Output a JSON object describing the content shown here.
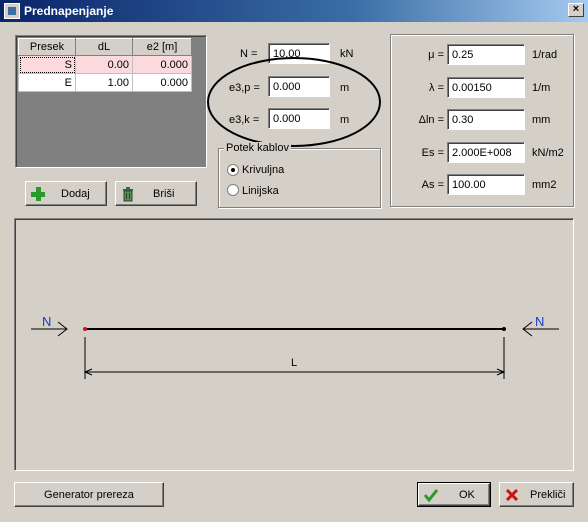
{
  "window": {
    "title": "Prednapenjanje",
    "close_glyph": "×"
  },
  "table": {
    "headers": [
      "Presek",
      "dL",
      "e2 [m]"
    ],
    "rows": [
      {
        "presek": "S",
        "dl": "0.00",
        "e2": "0.000",
        "selected": true
      },
      {
        "presek": "E",
        "dl": "1.00",
        "e2": "0.000",
        "selected": false
      }
    ]
  },
  "buttons": {
    "dodaj": "Dodaj",
    "brisi": "Briši",
    "generator": "Generator prereza",
    "ok": "OK",
    "preklici": "Prekliči"
  },
  "params": {
    "n": {
      "label": "N =",
      "value": "10.00",
      "unit": "kN"
    },
    "e3p": {
      "label": "e3,p =",
      "value": "0.000",
      "unit": "m"
    },
    "e3k": {
      "label": "e3,k =",
      "value": "0.000",
      "unit": "m"
    }
  },
  "cable_path": {
    "title": "Potek kablov",
    "options": [
      {
        "label": "Krivuljna",
        "selected": true
      },
      {
        "label": "Linijska",
        "selected": false
      }
    ]
  },
  "props": {
    "mu": {
      "label": "μ =",
      "value": "0.25",
      "unit": "1/rad"
    },
    "lambda": {
      "label": "λ =",
      "value": "0.00150",
      "unit": "1/m"
    },
    "dln": {
      "label": "Δln =",
      "value": "0.30",
      "unit": "mm"
    },
    "es": {
      "label": "Es =",
      "value": "2.000E+008",
      "unit": "kN/m2"
    },
    "as": {
      "label": "As =",
      "value": "100.00",
      "unit": "mm2"
    }
  },
  "diagram": {
    "left_force": "N",
    "right_force": "N",
    "length_label": "L"
  },
  "colors": {
    "accent_green": "#2a9a2a",
    "accent_red": "#d01010",
    "force_blue": "#1a3cd0",
    "row_highlight": "#fbd9dc"
  }
}
